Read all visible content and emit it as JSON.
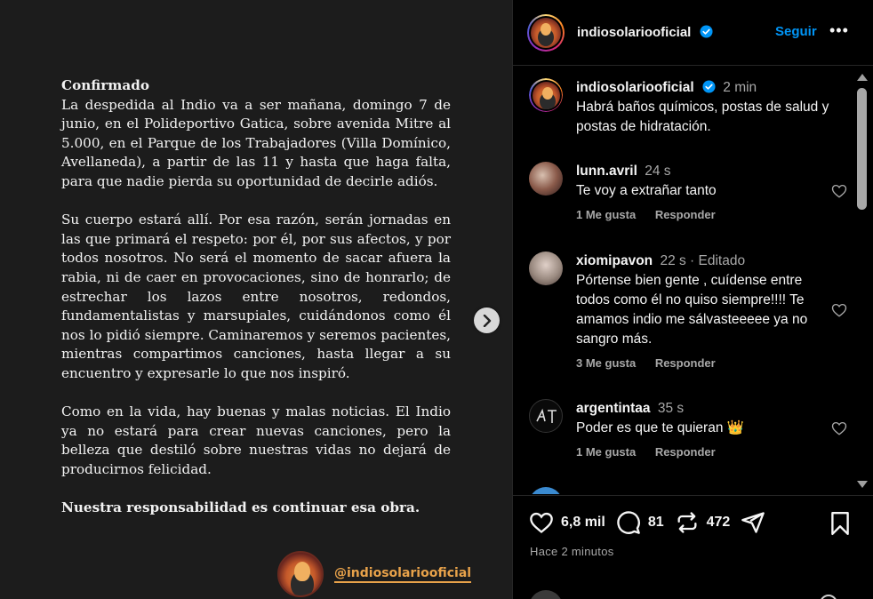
{
  "post": {
    "heading": "Confirmado",
    "paragraphs": [
      "La despedida al Indio va a ser mañana, domingo 7 de junio, en el Polideportivo Gatica, sobre avenida Mitre al 5.000, en el Parque de los Trabajadores (Villa Domínico, Avellaneda), a partir de las 11 y hasta que haga falta, para que nadie pierda su oportunidad de decirle adiós.",
      "Su cuerpo estará allí. Por esa razón, serán jornadas en las que primará el respeto: por él, por sus afectos, y por todos nosotros. No será el momento de sacar afuera la rabia, ni de caer en provocaciones, sino de honrarlo; de estrechar los lazos entre nosotros, redondos, fundamentalistas y marsupiales, cuidándonos como él nos lo pidió siempre. Caminaremos y seremos pacientes, mientras compartimos canciones, hasta llegar a su encuentro y expresarle lo que nos inspiró.",
      "Como en la vida, hay buenas y malas noticias. El Indio ya no estará para crear nuevas canciones, pero la belleza que destiló sobre nuestras vidas no dejará de producirnos felicidad."
    ],
    "closing": "Nuestra responsabilidad es continuar esa obra.",
    "brand_handle": "@indiosolariooficial",
    "next_icon": "chevron-right-icon"
  },
  "header": {
    "username": "indiosolariooficial",
    "follow_label": "Seguir",
    "more_label": "•••"
  },
  "caption": {
    "username": "indiosolariooficial",
    "time": "2 min",
    "text": "Habrá baños químicos, postas de salud y postas de hidratación."
  },
  "comments": [
    {
      "username": "lunn.avril",
      "time": "24 s",
      "text": "Te voy a extrañar tanto",
      "likes": "1 Me gusta",
      "reply": "Responder"
    },
    {
      "username": "xiomipavon",
      "time": "22 s · Editado",
      "text": "Pórtense bien gente , cuídense entre todos como él no quiso siempre!!!! Te amamos indio me sálvasteeeee ya no sangro más.",
      "likes": "3 Me gusta",
      "reply": "Responder"
    },
    {
      "username": "argentintaa",
      "time": "35 s",
      "text": "Poder es que te quieran 👑",
      "likes": "1 Me gusta",
      "reply": "Responder"
    }
  ],
  "actions": {
    "likes": "6,8 mil",
    "comments": "81",
    "reposts": "472",
    "posted": "Hace 2 minutos"
  },
  "colors": {
    "accent": "#0095f6",
    "brand": "#e8a24a",
    "muted": "#a8a8a8"
  }
}
